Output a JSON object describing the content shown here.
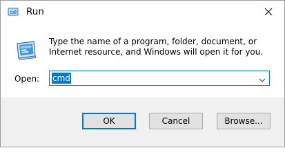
{
  "window": {
    "title": "Run",
    "icons": {
      "app": "run-app-icon",
      "close": "close-icon",
      "big": "run-big-icon",
      "dropdown": "chevron-down-icon"
    }
  },
  "content": {
    "description": "Type the name of a program, folder, document, or Internet resource, and Windows will open it for you.",
    "open_label": "Open:",
    "open_value": "cmd"
  },
  "buttons": {
    "ok": "OK",
    "cancel": "Cancel",
    "browse": "Browse..."
  },
  "colors": {
    "accent": "#0078d7",
    "footer_bg": "#f0f0f0",
    "button_bg": "#e1e1e1"
  }
}
